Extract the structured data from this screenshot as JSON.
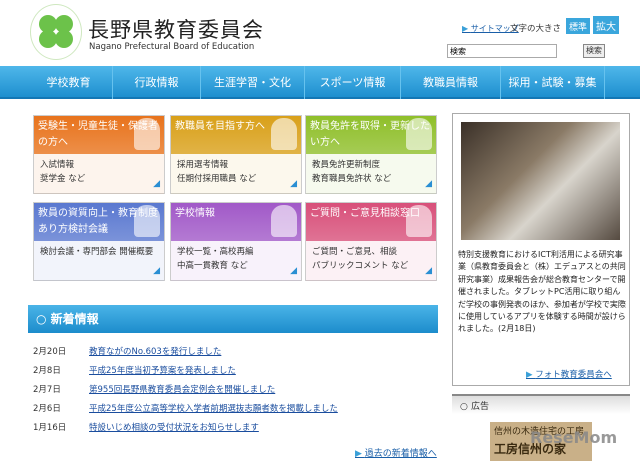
{
  "header": {
    "title": "長野県教育委員会",
    "subtitle": "Nagano Prefectural Board of Education",
    "sitemap": "サイトマップ",
    "font_size_label": "文字の大きさ",
    "font_standard": "標準",
    "font_large": "拡大",
    "search_value": "検索",
    "search_button": "検索"
  },
  "nav": [
    "学校教育",
    "行政情報",
    "生涯学習・文化",
    "スポーツ情報",
    "教職員情報",
    "採用・試験・募集"
  ],
  "cards": [
    {
      "title": "受験生・児童生徒・保護者の方へ",
      "body": "入試情報\n奨学金 など",
      "color": "#e8731c"
    },
    {
      "title": "教職員を目指す方へ",
      "body": "採用選考情報\n任期付採用職員 など",
      "color": "#d9a019"
    },
    {
      "title": "教員免許を取得・更新したい方へ",
      "body": "教員免許更新制度\n教育職員免許状 など",
      "color": "#8fbf2a"
    },
    {
      "title": "教員の資質向上・教育制度あり方検討会議",
      "body": "検討会議・専門部会 開催概要",
      "color": "#5a78d0"
    },
    {
      "title": "学校情報",
      "body": "学校一覧・高校再編\n中高一貫教育 など",
      "color": "#a159c8"
    },
    {
      "title": "ご質問・ご意見相談窓口",
      "body": "ご質問・ご意見、相談\nパブリックコメント など",
      "color": "#d8507a"
    }
  ],
  "news": {
    "title": "新着情報",
    "items": [
      {
        "date": "2月20日",
        "text": "教育ながのNo.603を発行しました"
      },
      {
        "date": "2月8日",
        "text": "平成25年度当初予算案を発表しました"
      },
      {
        "date": "2月7日",
        "text": "第955回長野県教育委員会定例会を開催しました"
      },
      {
        "date": "2月6日",
        "text": "平成25年度公立高等学校入学者前期選抜志願者数を掲載しました"
      },
      {
        "date": "1月16日",
        "text": "特設いじめ相談の受付状況をお知らせします"
      }
    ],
    "past": "過去の新着情報へ"
  },
  "photo": {
    "text": "特別支援教育におけるICT利活用による研究事業（県教育委員会と（株）エデュアスとの共同研究事業）成果報告会が総合教育センターで開催されました。タブレットPC活用に取り組んだ学校の事例発表のほか、参加者が学校で実際に使用しているアプリを体験する時間が設けられました。(2月18日)",
    "link": "フォト教育委員会へ"
  },
  "ad": {
    "title": "広告",
    "banner_line1": "信州の木造住宅の工房",
    "banner_line2": "工房信州の家"
  },
  "watermark": "ReseMom"
}
